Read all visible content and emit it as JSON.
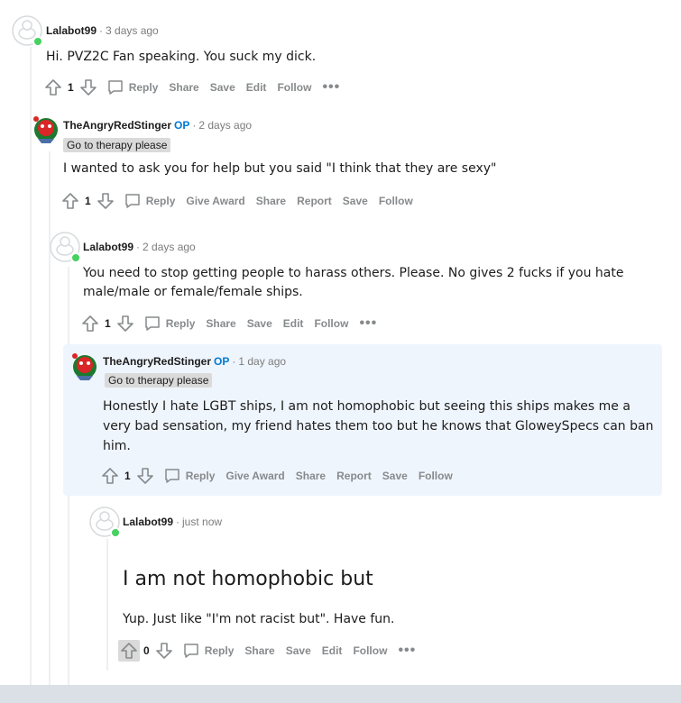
{
  "comments": [
    {
      "author": "Lalabot99",
      "time": "3 days ago",
      "body": "Hi. PVZ2C Fan speaking. You suck my dick.",
      "score": "1",
      "actions": [
        "Reply",
        "Share",
        "Save",
        "Edit",
        "Follow"
      ]
    },
    {
      "author": "TheAngryRedStinger",
      "op_label": "OP",
      "time": "2 days ago",
      "flair": "Go to therapy please",
      "body": "I wanted to ask you for help but you said \"I think that they are sexy\"",
      "score": "1",
      "actions": [
        "Reply",
        "Give Award",
        "Share",
        "Report",
        "Save",
        "Follow"
      ]
    },
    {
      "author": "Lalabot99",
      "time": "2 days ago",
      "body_lines": [
        "You need to stop getting people to harass others. Please. No gives 2 fucks if you hate",
        "male/male or female/female ships."
      ],
      "score": "1",
      "actions": [
        "Reply",
        "Share",
        "Save",
        "Edit",
        "Follow"
      ]
    },
    {
      "author": "TheAngryRedStinger",
      "op_label": "OP",
      "time": "1 day ago",
      "flair": "Go to therapy please",
      "body_lines": [
        "Honestly I hate LGBT ships, I am not homophobic but seeing this ships makes me a",
        "very bad sensation, my friend hates them too but he knows that GloweySpecs can ban",
        "him."
      ],
      "score": "1",
      "actions": [
        "Reply",
        "Give Award",
        "Share",
        "Report",
        "Save",
        "Follow"
      ]
    },
    {
      "author": "Lalabot99",
      "time": "just now",
      "heading": "I am not homophobic but",
      "body": "Yup. Just like \"I'm not racist but\". Have fun.",
      "score": "0",
      "actions": [
        "Reply",
        "Share",
        "Save",
        "Edit",
        "Follow"
      ]
    }
  ],
  "more_label": "•••",
  "separator": "·",
  "colors": {
    "op": "#0079d3",
    "online": "#46d160",
    "highlight": "#eff5fd",
    "action": "#878a8c"
  },
  "icons": [
    "upvote-icon",
    "downvote-icon",
    "comment-bubble-icon",
    "avatar-snoo-icon",
    "avatar-stinger-icon",
    "more-icon"
  ]
}
